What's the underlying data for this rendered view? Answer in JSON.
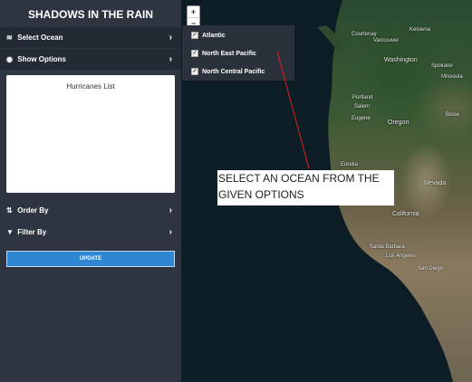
{
  "sidebar": {
    "title": "SHADOWS IN THE RAIN",
    "select_ocean": "Select Ocean",
    "show_options": "Show Options",
    "hurricanes_list_title": "Hurricanes List",
    "order_by": "Order By",
    "filter_by": "Filter By",
    "update_button": "UPDATE"
  },
  "zoom": {
    "in": "+",
    "out": "−"
  },
  "ocean_options": [
    {
      "label": "Atlantic",
      "checked": true
    },
    {
      "label": "North East Pacific",
      "checked": true
    },
    {
      "label": "North Central Pacific",
      "checked": true
    }
  ],
  "annotation": "SELECT AN OCEAN FROM THE GIVEN OPTIONS",
  "map_labels": {
    "courtenay": "Courtenay",
    "kelowna": "Kelowna",
    "vancouver": "Vancouver",
    "washington": "Washington",
    "spokane": "Spokane",
    "missoula": "Missoula",
    "portland": "Portland",
    "salem": "Salem",
    "eugene": "Eugene",
    "oregon": "Oregon",
    "boise": "Boise",
    "eureka": "Eureka",
    "nevada": "Nevada",
    "california": "California",
    "santa_barbara": "Santa Barbara",
    "los_angeles": "Los Angeles",
    "san_diego": "San Diego"
  }
}
